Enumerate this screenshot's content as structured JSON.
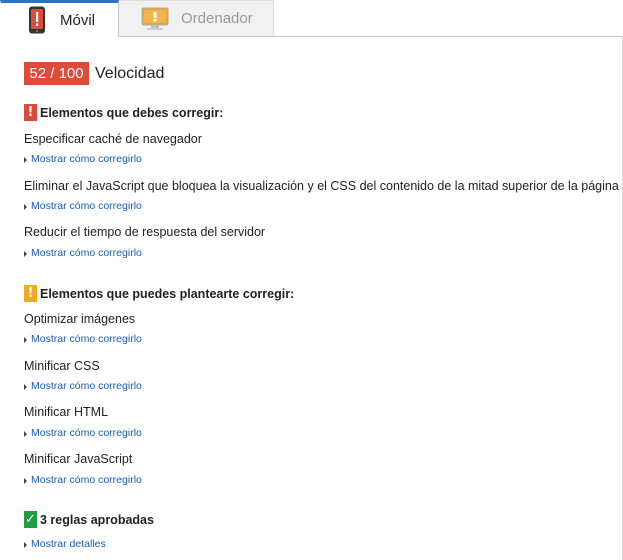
{
  "tabs": [
    {
      "label": "Móvil",
      "icon": "mobile-phone-icon",
      "active": true
    },
    {
      "label": "Ordenador",
      "icon": "desktop-monitor-icon",
      "active": false
    }
  ],
  "score": {
    "value": "52 / 100",
    "label": "Velocidad",
    "color": "#dd4b39"
  },
  "must_fix": {
    "icon_glyph": "!",
    "title": "Elementos que debes corregir:",
    "rules": [
      {
        "title": "Especificar caché de navegador",
        "link": "Mostrar cómo corregirlo"
      },
      {
        "title": "Eliminar el JavaScript que bloquea la visualización y el CSS del contenido de la mitad superior de la página",
        "link": "Mostrar cómo corregirlo"
      },
      {
        "title": "Reducir el tiempo de respuesta del servidor",
        "link": "Mostrar cómo corregirlo"
      }
    ]
  },
  "consider_fix": {
    "icon_glyph": "!",
    "title": "Elementos que puedes plantearte corregir:",
    "rules": [
      {
        "title": "Optimizar imágenes",
        "link": "Mostrar cómo corregirlo"
      },
      {
        "title": "Minificar CSS",
        "link": "Mostrar cómo corregirlo"
      },
      {
        "title": "Minificar HTML",
        "link": "Mostrar cómo corregirlo"
      },
      {
        "title": "Minificar JavaScript",
        "link": "Mostrar cómo corregirlo"
      }
    ]
  },
  "passed": {
    "icon_glyph": "✓",
    "title": "3 reglas aprobadas",
    "link": "Mostrar detalles"
  },
  "colors": {
    "danger": "#dd4b39",
    "warning": "#f5a623",
    "success": "#1e9e3e",
    "link": "#1a5bb8",
    "tab_accent": "#2c72c7"
  }
}
